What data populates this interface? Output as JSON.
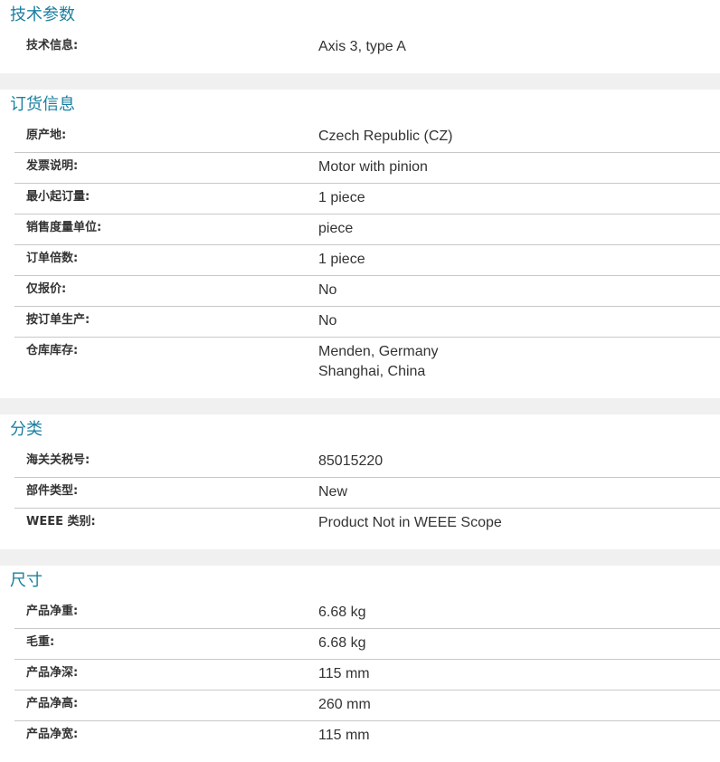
{
  "sections": {
    "tech": {
      "title": "技术参数",
      "rows": [
        {
          "label": "技术信息:",
          "value": "Axis 3, type A"
        }
      ]
    },
    "order": {
      "title": "订货信息",
      "rows": [
        {
          "label": "原产地:",
          "value": "Czech Republic (CZ)"
        },
        {
          "label": "发票说明:",
          "value": "Motor with pinion"
        },
        {
          "label": "最小起订量:",
          "value": "1 piece"
        },
        {
          "label": "销售度量单位:",
          "value": "piece"
        },
        {
          "label": "订单倍数:",
          "value": "1 piece"
        },
        {
          "label": "仅报价:",
          "value": "No"
        },
        {
          "label": "按订单生产:",
          "value": "No"
        },
        {
          "label": "仓库库存:",
          "value_lines": [
            "Menden, Germany",
            "Shanghai, China"
          ]
        }
      ]
    },
    "class": {
      "title": "分类",
      "rows": [
        {
          "label": "海关关税号:",
          "value": "85015220"
        },
        {
          "label": "部件类型:",
          "value": "New"
        },
        {
          "label": "WEEE 类别:",
          "value": "Product Not in WEEE Scope"
        }
      ]
    },
    "dim": {
      "title": "尺寸",
      "rows": [
        {
          "label": "产品净重:",
          "value": "6.68 kg"
        },
        {
          "label": "毛重:",
          "value": "6.68 kg"
        },
        {
          "label": "产品净深:",
          "value": "115 mm"
        },
        {
          "label": "产品净高:",
          "value": "260 mm"
        },
        {
          "label": "产品净宽:",
          "value": "115 mm"
        }
      ]
    }
  }
}
